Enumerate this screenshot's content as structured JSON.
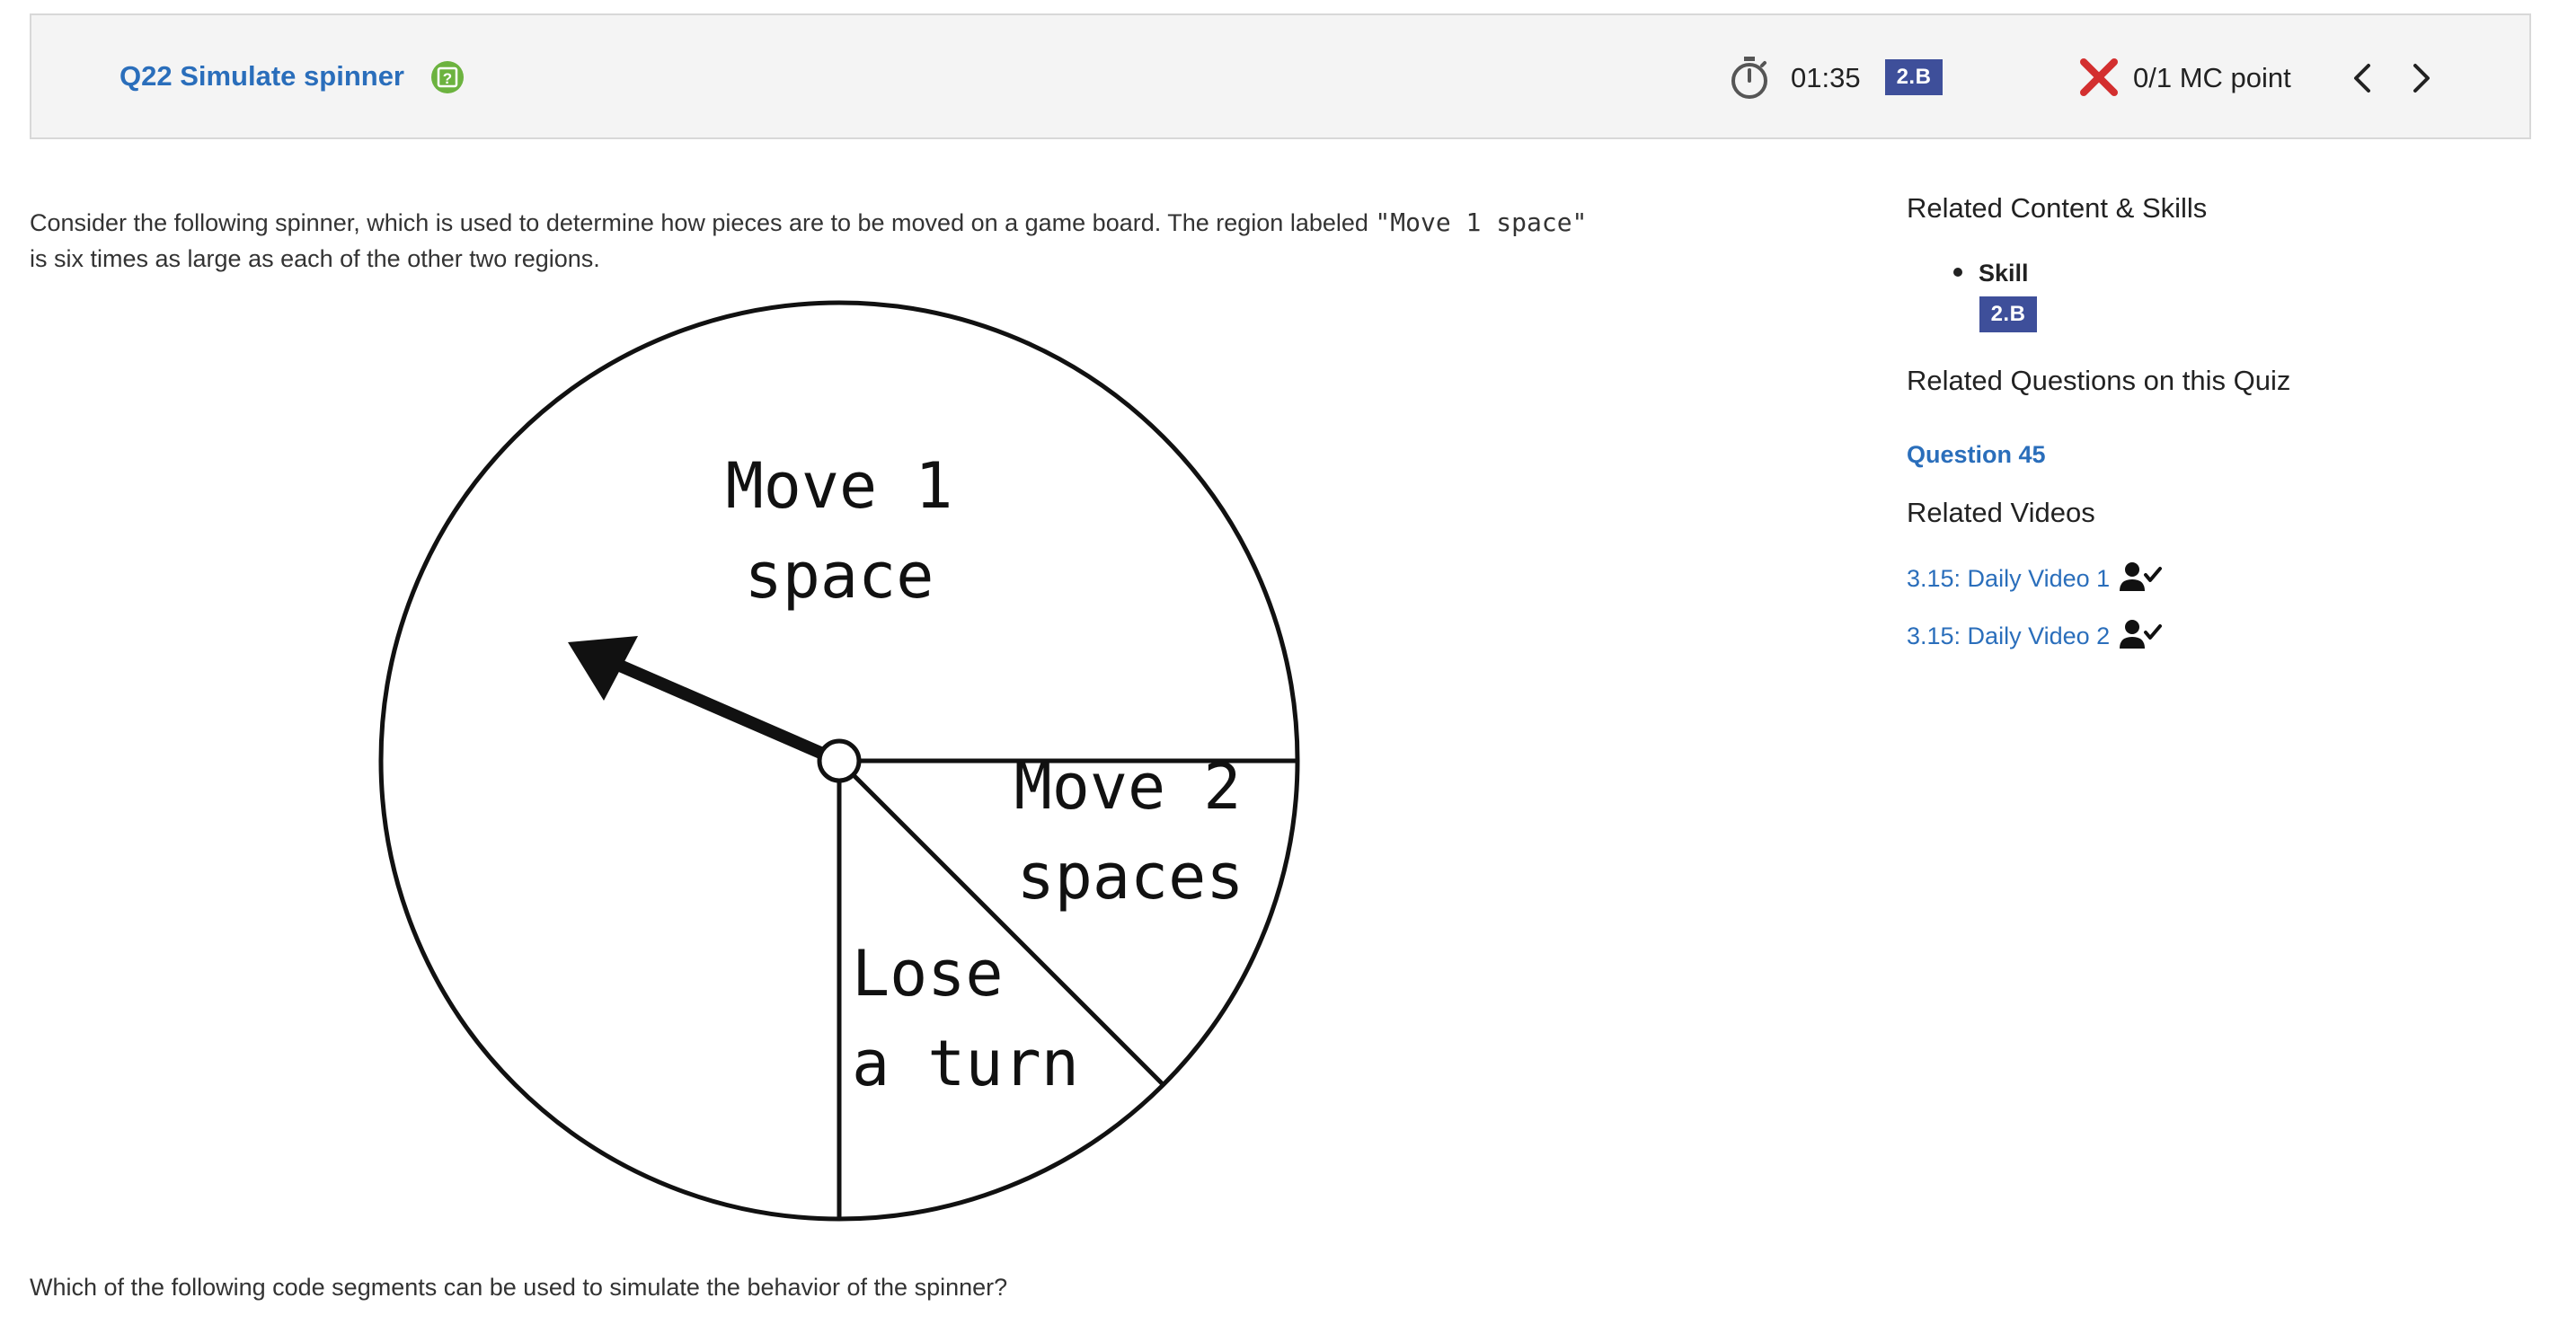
{
  "header": {
    "question_title": "Q22 Simulate spinner",
    "help_icon": "help-question-icon",
    "timer_icon": "stopwatch-icon",
    "timer": "01:35",
    "skill_badge": "2.B",
    "result_icon": "incorrect-x-icon",
    "score": "0/1 MC point",
    "prev_icon": "chevron-left-icon",
    "next_icon": "chevron-right-icon"
  },
  "question": {
    "prompt_part1": "Consider the following spinner, which is used to determine how pieces are to be moved on a game board. The region labeled ",
    "prompt_code": "\"Move 1 space\"",
    "prompt_part2": " is six times as large as each of the other two regions.",
    "spinner": {
      "region_large_line1": "Move 1",
      "region_large_line2": "space",
      "region_small1_line1": "Move 2",
      "region_small1_line2": "spaces",
      "region_small2_line1": "Lose",
      "region_small2_line2": "a turn"
    },
    "follow_up": "Which of the following code segments can be used to simulate the behavior of the spinner?"
  },
  "sidebar": {
    "related_content_heading": "Related Content & Skills",
    "skill_label": "Skill",
    "skill_badge": "2.B",
    "related_questions_heading": "Related Questions on this Quiz",
    "related_question_link": "Question 45",
    "related_videos_heading": "Related Videos",
    "videos": [
      {
        "label": "3.15: Daily Video 1",
        "icon": "person-check-icon"
      },
      {
        "label": "3.15: Daily Video 2",
        "icon": "person-check-icon"
      }
    ]
  },
  "colors": {
    "link": "#2a6ebb",
    "badge": "#3e4f9a",
    "help_green": "#6cb33f",
    "error_red": "#d32f2f"
  }
}
